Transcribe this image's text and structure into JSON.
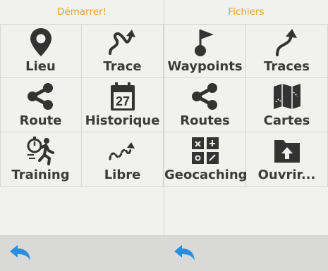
{
  "left_panel": {
    "title": "Démarrer!",
    "items": [
      {
        "label": "Lieu",
        "icon": "location-pin-icon"
      },
      {
        "label": "Trace",
        "icon": "track-arrow-icon"
      },
      {
        "label": "Route",
        "icon": "route-share-icon"
      },
      {
        "label": "Historique",
        "icon": "calendar-icon",
        "badge": "27"
      },
      {
        "label": "Training",
        "icon": "runner-stopwatch-icon"
      },
      {
        "label": "Libre",
        "icon": "free-path-icon"
      }
    ]
  },
  "right_panel": {
    "title": "Fichiers",
    "items": [
      {
        "label": "Waypoints",
        "icon": "flag-pin-icon"
      },
      {
        "label": "Traces",
        "icon": "curve-arrow-icon"
      },
      {
        "label": "Routes",
        "icon": "route-share-icon"
      },
      {
        "label": "Cartes",
        "icon": "map-icon"
      },
      {
        "label": "Geocaching",
        "icon": "geocache-icon"
      },
      {
        "label": "Ouvrir...",
        "icon": "folder-open-icon"
      }
    ]
  },
  "footer": {
    "back_icon": "back-arrow-icon",
    "accent_color": "#2a8ee0"
  },
  "colors": {
    "header_text": "#e6a23a",
    "label_text": "#3b3b3b",
    "icon": "#333333"
  }
}
